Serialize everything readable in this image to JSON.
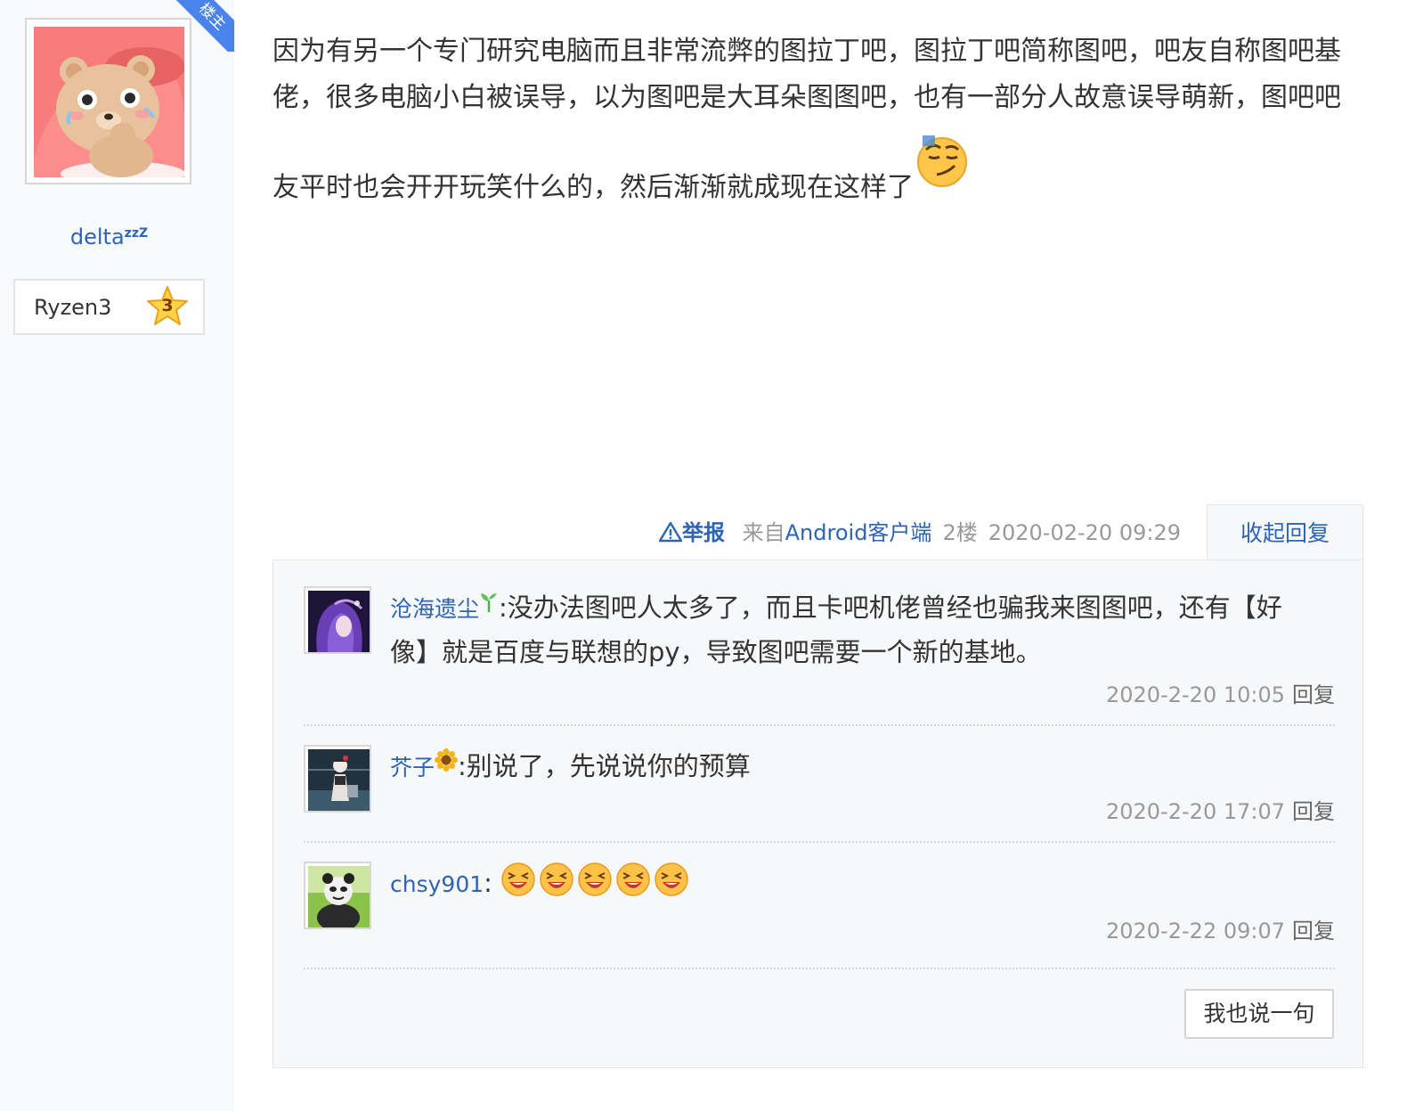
{
  "author": {
    "name": "delta",
    "name_suffix": "zzZ",
    "op_badge": "楼主",
    "level_name": "Ryzen3",
    "level_number": "3"
  },
  "post": {
    "lines": [
      "因为有另一个专门研究电脑而且非常流弊的图拉丁吧，图拉丁吧简称图吧，吧友自称图吧基",
      "佬，很多电脑小白被误导，以为图吧是大耳朵图图吧，也有一部分人故意误导萌新，图吧吧",
      "友平时也会开开玩笑什么的，然后渐渐就成现在这样了"
    ],
    "emoji": "smirk-emoji"
  },
  "meta": {
    "report_icon": "warning-icon",
    "report_label": "举报",
    "from_prefix": "来自",
    "client_label": "Android客户端",
    "floor": "2楼",
    "timestamp": "2020-02-20 09:29",
    "collapse_label": "收起回复"
  },
  "replies": [
    {
      "user": "沧海遗尘",
      "badge": "sprout-icon",
      "separator": ":",
      "text_line1": "没办法图吧人太多了，而且卡吧机佬曾经也骗我来图图吧，还有【好",
      "text_line2": "像】就是百度与联想的py，导致图吧需要一个新的基地。",
      "time": "2020-2-20 10:05",
      "reply_label": "回复"
    },
    {
      "user": "芥子",
      "badge": "sunflower-icon",
      "separator": ":",
      "text_line1": "别说了，先说说你的预算",
      "time": "2020-2-20 17:07",
      "reply_label": "回复"
    },
    {
      "user": "chsy901",
      "separator": ":",
      "emoji": "laughing-emoji",
      "emoji_count": 5,
      "time": "2020-2-22 09:07",
      "reply_label": "回复"
    }
  ],
  "say_button_label": "我也说一句",
  "colors": {
    "link": "#2d64b3",
    "muted": "#999999",
    "badge_blue": "#4a84ea",
    "reply_bg": "#f7f8fa"
  }
}
